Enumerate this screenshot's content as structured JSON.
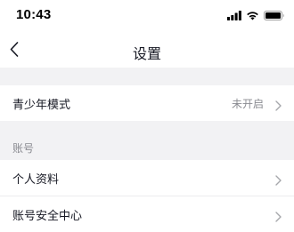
{
  "status_bar": {
    "time": "10:43",
    "icons": [
      "signal-bars-icon",
      "wifi-icon",
      "battery-icon"
    ]
  },
  "nav": {
    "back_icon": "chevron-left-icon",
    "title": "设置"
  },
  "settings": {
    "teen_mode": {
      "label": "青少年模式",
      "value": "未开启",
      "icon": "chevron-right-icon"
    },
    "account_section": {
      "title": "账号",
      "items": [
        {
          "label": "个人资料",
          "icon": "chevron-right-icon"
        },
        {
          "label": "账号安全中心",
          "icon": "chevron-right-icon"
        }
      ]
    }
  },
  "colors": {
    "background": "#ffffff",
    "section_gap": "#f2f2f4",
    "primary_text": "#161823",
    "secondary_text": "#8a8b91",
    "chevron": "#a6a7ab"
  }
}
